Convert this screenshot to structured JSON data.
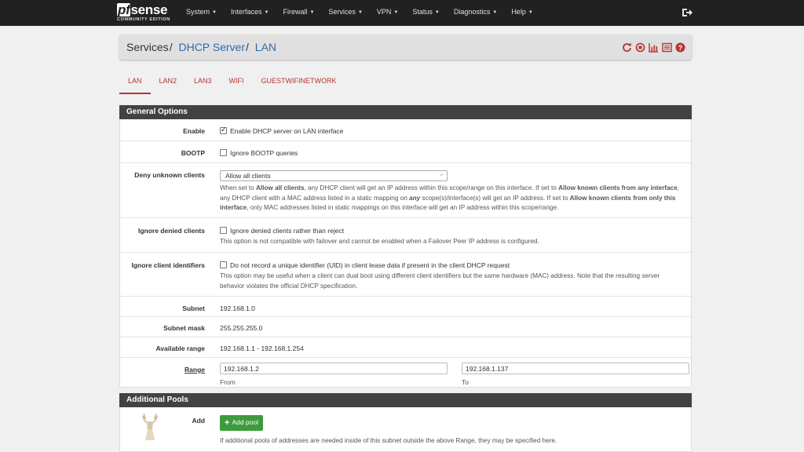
{
  "logo": {
    "brand_pf": "pf",
    "brand_rest": "sense",
    "edition": "COMMUNITY EDITION"
  },
  "nav": [
    {
      "label": "System"
    },
    {
      "label": "Interfaces"
    },
    {
      "label": "Firewall"
    },
    {
      "label": "Services"
    },
    {
      "label": "VPN"
    },
    {
      "label": "Status"
    },
    {
      "label": "Diagnostics"
    },
    {
      "label": "Help"
    }
  ],
  "breadcrumb": {
    "root": "Services",
    "section": "DHCP Server",
    "page": "LAN"
  },
  "colors": {
    "navbar": "#212121",
    "accent_red": "#b53431",
    "link_blue": "#2f6ba8",
    "panel_header": "#424242",
    "add_green": "#3d9b3d"
  },
  "tabs": [
    {
      "label": "LAN"
    },
    {
      "label": "LAN2"
    },
    {
      "label": "LAN3"
    },
    {
      "label": "WIFI"
    },
    {
      "label": "GUESTWIFINETWORK"
    }
  ],
  "general": {
    "title": "General Options",
    "enable": {
      "label": "Enable",
      "text": "Enable DHCP server on LAN interface",
      "checked": true
    },
    "bootp": {
      "label": "BOOTP",
      "text": "Ignore BOOTP queries",
      "checked": false
    },
    "deny": {
      "label": "Deny unknown clients",
      "selected": "Allow all clients",
      "help_1": "When set to ",
      "help_b1": "Allow all clients",
      "help_2": ", any DHCP client will get an IP address within this scope/range on this interface. If set to ",
      "help_b2": "Allow known clients from any interface",
      "help_3": ", any DHCP client with a MAC address listed in a static mapping on ",
      "help_b3": "any",
      "help_4": " scope(s)/interface(s) will get an IP address. If set to ",
      "help_b4": "Allow known clients from only this interface",
      "help_5": ", only MAC addresses listed in static mappings on this interface will get an IP address within this scope/range."
    },
    "ignore_denied": {
      "label": "Ignore denied clients",
      "text": "Ignore denied clients rather than reject",
      "help": "This option is not compatible with failover and cannot be enabled when a Failover Peer IP address is configured."
    },
    "ignore_uid": {
      "label": "Ignore client identifiers",
      "text": "Do not record a unique identifier (UID) in client lease data if present in the client DHCP request",
      "help": "This option may be useful when a client can dual boot using different client identifiers but the same hardware (MAC) address. Note that the resulting server behavior violates the official DHCP specification."
    },
    "subnet": {
      "label": "Subnet",
      "value": "192.168.1.0"
    },
    "mask": {
      "label": "Subnet mask",
      "value": "255.255.255.0"
    },
    "avail": {
      "label": "Available range",
      "value": "192.168.1.1 - 192.168.1.254"
    },
    "range": {
      "label": "Range",
      "from": "192.168.1.2",
      "to": "192.168.1.137",
      "from_label": "From",
      "to_label": "To"
    }
  },
  "pools": {
    "title": "Additional Pools",
    "add_label": "Add",
    "button": "Add pool",
    "help": "If additional pools of addresses are needed inside of this subnet outside the above Range, they may be specified here."
  }
}
